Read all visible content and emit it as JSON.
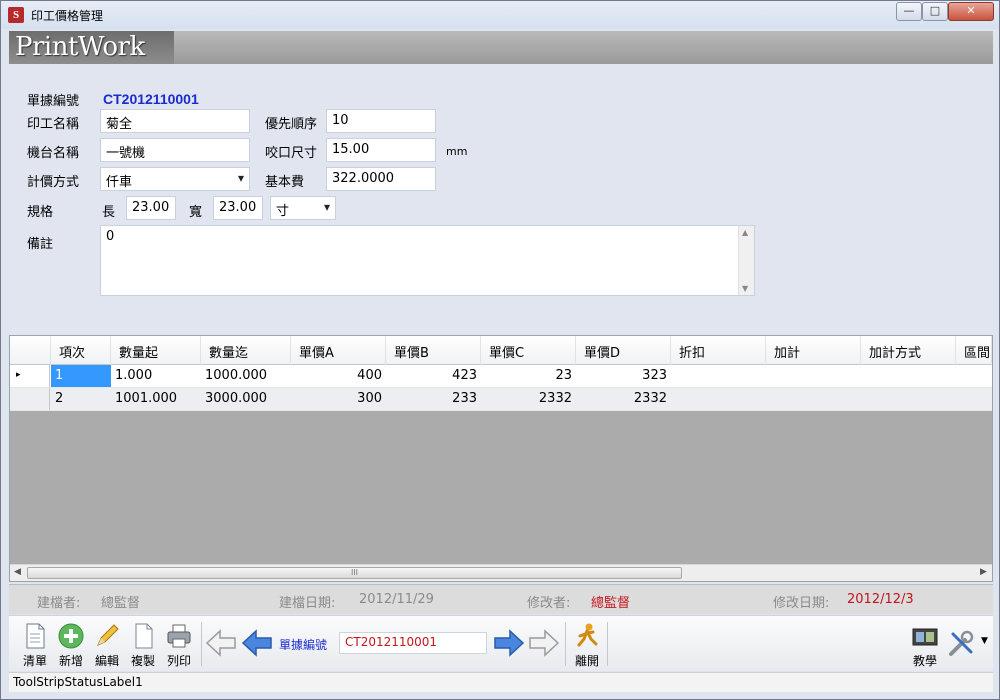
{
  "window": {
    "title": "印工價格管理",
    "icon": "app-logo-icon"
  },
  "banner": {
    "logo_text": "PrintWork"
  },
  "form": {
    "doc_no_label": "單據編號",
    "doc_no_value": "CT2012110001",
    "name_label": "印工名稱",
    "name_value": "菊全",
    "priority_label": "優先順序",
    "priority_value": "10",
    "machine_label": "機台名稱",
    "machine_value": "一號機",
    "bite_label": "咬口尺寸",
    "bite_value": "15.00",
    "bite_unit": "mm",
    "pricing_label": "計價方式",
    "pricing_value": "仟車",
    "base_fee_label": "基本費",
    "base_fee_value": "322.0000",
    "spec_label": "規格",
    "length_label": "長",
    "length_value": "23.00",
    "width_label": "寬",
    "width_value": "23.00",
    "unit_value": "寸",
    "memo_label": "備註",
    "memo_value": "0"
  },
  "grid": {
    "columns": [
      "項次",
      "數量起",
      "數量迄",
      "單價A",
      "單價B",
      "單價C",
      "單價D",
      "折扣",
      "加計",
      "加計方式",
      "區間"
    ],
    "rows": [
      [
        "1",
        "1.000",
        "1000.000",
        "400",
        "423",
        "23",
        "323",
        "",
        "",
        "",
        ""
      ],
      [
        "2",
        "1001.000",
        "3000.000",
        "300",
        "233",
        "2332",
        "2332",
        "",
        "",
        "",
        ""
      ]
    ],
    "current_row_marker": "▸",
    "scroll_grip": "III"
  },
  "audit": {
    "creator_label": "建檔者:",
    "creator_value": "總監督",
    "created_date_label": "建檔日期:",
    "created_date_value": "2012/11/29",
    "modifier_label": "修改者:",
    "modifier_value": "總監督",
    "modified_date_label": "修改日期:",
    "modified_date_value": "2012/12/3"
  },
  "toolbar": {
    "clear_label": "清單",
    "add_label": "新增",
    "edit_label": "編輯",
    "copy_label": "複製",
    "print_label": "列印",
    "nav_field_label": "單據編號",
    "nav_field_value": "CT2012110001",
    "exit_label": "離開",
    "tutorial_label": "教學"
  },
  "status_bar": {
    "text": "ToolStripStatusLabel1"
  },
  "colors": {
    "doc_no_blue": "#1a2cd0",
    "audit_red": "#c4151c",
    "selection_blue": "#3399ff",
    "grid_empty_gray": "#ababab"
  }
}
